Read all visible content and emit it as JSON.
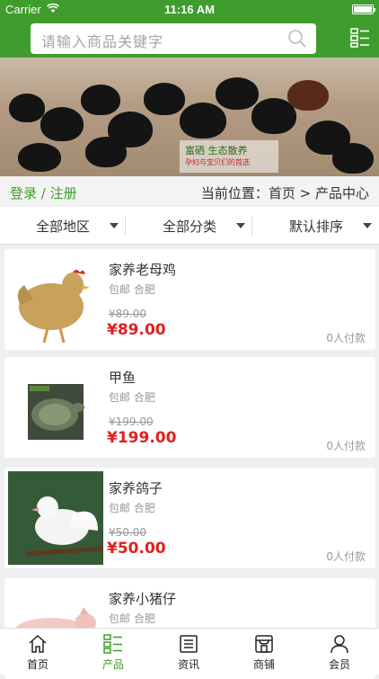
{
  "status_bar": {
    "carrier": "Carrier",
    "time": "11:16 AM"
  },
  "search": {
    "placeholder": "请输入商品关键字"
  },
  "breadcrumb": {
    "login_register": "登录 / 注册",
    "location": "当前位置：首页 > 产品中心"
  },
  "banner": {
    "tag_line1": "富硒 生态散养",
    "tag_line2": "孕妇与宝贝们的首选"
  },
  "filters": [
    {
      "label": "全部地区"
    },
    {
      "label": "全部分类"
    },
    {
      "label": "默认排序"
    }
  ],
  "products": [
    {
      "name": "家养老母鸡",
      "tags": "包邮 合肥",
      "old_price": "¥89.00",
      "price": "¥89.00",
      "paid": "0人付款",
      "image": "hen-photo"
    },
    {
      "name": "甲鱼",
      "tags": "包邮 合肥",
      "old_price": "¥199.00",
      "price": "¥199.00",
      "paid": "0人付款",
      "image": "turtle-photo"
    },
    {
      "name": "家养鸽子",
      "tags": "包邮 合肥",
      "old_price": "¥50.00",
      "price": "¥50.00",
      "paid": "0人付款",
      "image": "pigeon-photo"
    },
    {
      "name": "家养小猪仔",
      "tags": "包邮 合肥",
      "old_price": "",
      "price": "",
      "paid": "",
      "image": "piglet-photo"
    }
  ],
  "tabbar": [
    {
      "label": "首页",
      "icon": "home-icon"
    },
    {
      "label": "产品",
      "icon": "product-grid-icon",
      "active": true
    },
    {
      "label": "资讯",
      "icon": "news-icon"
    },
    {
      "label": "商铺",
      "icon": "shop-icon"
    },
    {
      "label": "会员",
      "icon": "user-icon"
    }
  ],
  "colors": {
    "brand_green": "#3e9d2c",
    "price_red": "#e02020"
  }
}
